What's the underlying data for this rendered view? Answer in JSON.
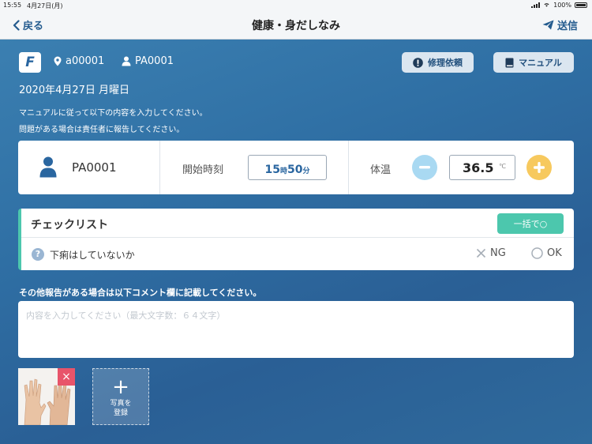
{
  "status_bar": {
    "time": "15:55",
    "date": "4月27日(月)",
    "battery": "100%"
  },
  "nav": {
    "back_label": "戻る",
    "title": "健康・身だしなみ",
    "send_label": "送信"
  },
  "header": {
    "logo_text": "F",
    "location_code": "a00001",
    "user_code": "PA0001",
    "repair_request_label": "修理依頼",
    "manual_label": "マニュアル"
  },
  "date_line": "2020年4月27日 月曜日",
  "instructions": {
    "line1": "マニュアルに従って以下の内容を入力してください。",
    "line2": "問題がある場合は責任者に報告してください。"
  },
  "main_card": {
    "user_id": "PA0001",
    "start_time_label": "開始時刻",
    "start_hour": "15",
    "hour_unit": "時",
    "start_minute": "50",
    "minute_unit": "分",
    "temp_label": "体温",
    "temp_value": "36.5",
    "temp_unit": "℃"
  },
  "checklist": {
    "title": "チェックリスト",
    "bulk_button": "一括で○",
    "items": [
      {
        "text": "下痢はしていないか",
        "ng_label": "NG",
        "ok_label": "OK"
      }
    ]
  },
  "comment": {
    "label": "その他報告がある場合は以下コメント欄に記載してください。",
    "placeholder": "内容を入力してください（最大文字数：６４文字）",
    "value": ""
  },
  "photos": {
    "delete_symbol": "×",
    "add_line1": "写真を",
    "add_line2": "登録"
  },
  "colors": {
    "accent": "#245b8e",
    "teal": "#4cc7ad",
    "minus": "#a9d9f2",
    "plus": "#f7c95e",
    "delete": "#e8546a"
  }
}
